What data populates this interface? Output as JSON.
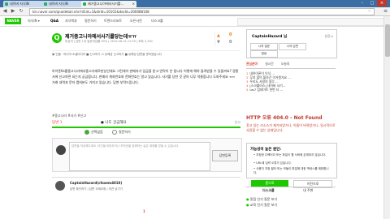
{
  "browser": {
    "tabs": [
      {
        "label": "네이버 지식iN"
      },
      {
        "label": "네이버 지식iN"
      },
      {
        "label": "제거중고니아에서사기를..."
      }
    ],
    "url": "kin.naver.com/qna/detail.nhn?d1id=1&dirId=10101&docId=200088108",
    "win_min": "–",
    "win_max": "□",
    "win_close": "×",
    "nav_back": "◀",
    "nav_forward": "▶",
    "nav_reload": "↻",
    "star": "☆",
    "menu": "≡"
  },
  "site": {
    "logo": "NAVER",
    "nav": [
      "지식iN ▾",
      "Q&A",
      "지식백과",
      "질문하기",
      "트렌드리포트",
      "오픈사전",
      "더스크롤"
    ],
    "active_nav": "Q&A"
  },
  "question": {
    "badge": "Q",
    "title": "제거중고니아에서사기를당는데ㅠㅠ",
    "meta": "비공개 | 답변 1개 질문마감률 90% | 2015.06.15 21:39 | 조회 3,100",
    "vote_up": "0",
    "vote_down": "0",
    "subline": "▣ 인물 · 미디어·소셜미디어 ■ 신고하기  ☑ 유해성 신고하기  ■ 유해성 답변을 못하였습니다",
    "body": "아이폰6s를중고나라에서중고거래로판상인데요 그런데이 판매자가 입금을 받고 연락이 안 됩니다 어떻게 해야 돌려받을 수 있을까요? 경찰서에 신고하면 되는지 궁금합니다. 판매자 계좌번호와 전화번호는 알고 있습니다. 사기를 당한 것 같아 너무 억울합니다 도와주세요 ㅠㅠ 거래 내역과 문자 캡처본도 가지고 있습니다. 답변 부탁드립니다.",
    "tags": "#중고나라 #사기 #신고"
  },
  "answer": {
    "heading": "답변 1",
    "option_label": "● 나도 궁금해요",
    "report": "신고",
    "radio_1": "선택없음",
    "radio_2": "질문하기",
    "placeholder": "답변을 작성해주세요. 타인을 비방하거나 저작권을 침해하는 글은 제재를 받을 수 있습니다.",
    "submit": "답변등록"
  },
  "reply": {
    "name": "CaptainHazard(cfosem4010)",
    "text": "답변 확인하기 | 답변 삭제요청 | 의견 남기기"
  },
  "pager": "1",
  "sidebar": {
    "username": "CaptainHazard 님",
    "settings": "설정 ▸",
    "tabs": [
      "나의 질문",
      "나의 답변",
      "알림"
    ],
    "ranking_tabs": [
      "관심분야",
      "실시간",
      "오늘의"
    ],
    "ranking": [
      {
        "n": "1",
        "t": "내아이폰이 인식 ..."
      },
      {
        "n": "2",
        "t": "무지 많이 올라간 이거뭔가요 ..."
      },
      {
        "n": "3",
        "t": "우리도 사람의 생각 ..."
      },
      {
        "n": "4",
        "t": "[스크롤러스] 네이버 사기..."
      },
      {
        "n": "5",
        "t": "ios7 업데이트 한번 더 ..."
      }
    ],
    "error_title": "HTTP 오류 404.0 - Not Found",
    "error_desc": "찾고 있는 리소스가 제거되었거나, 이름이 바뀌었거나, 일시적으로 사용할 수 없는 상태입니다.",
    "error_box_title": "가능성이 높은 원인:",
    "error_items": [
      "• 지정한 디렉터리 또는 파일이 웹 서버에 존재하지 않습니다.",
      "• URL에 입력 오류가 있습니다.",
      "• 사용자 지정 필터 또는 모듈이 파일에 대한 액세스를 제한합니다."
    ],
    "btn_home": "홈으로",
    "btn_back": "이전으로",
    "bottom_tabs": [
      "더스크롤",
      "내 주변"
    ],
    "bottom_list": [
      "맛집 인기 질문 보기",
      "교육 인기 질문 보기"
    ]
  },
  "colors": {
    "accent": "#1ec800",
    "error": "#c0392b",
    "tabbar": "#3a6ea5"
  }
}
